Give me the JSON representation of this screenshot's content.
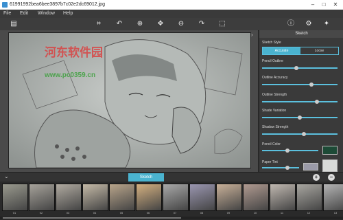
{
  "window": {
    "title": "61991992bea6bee3897b7c02e2dc69012.jpg",
    "minimize": "–",
    "maximize": "□",
    "close": "✕"
  },
  "menu": {
    "file": "File",
    "edit": "Edit",
    "window": "Window",
    "help": "Help"
  },
  "toolbar": {
    "icons": [
      "open-icon",
      "crop-icon",
      "undo-icon",
      "zoom-in-icon",
      "move-icon",
      "zoom-out-icon",
      "redo-icon",
      "fit-icon",
      "info-icon",
      "settings-icon",
      "effects-icon"
    ]
  },
  "watermark": {
    "text": "河东软件园",
    "url": "www.pc0359.cn"
  },
  "panel": {
    "header": "Sketch",
    "sketch_style_label": "Sketch Style",
    "style_options": [
      "Accurate",
      "Loose"
    ],
    "selected_style": "Accurate",
    "sliders": [
      {
        "label": "Pencil Outline",
        "value": 0.45
      },
      {
        "label": "Outline Accuracy",
        "value": 0.65
      },
      {
        "label": "Outline Strength",
        "value": 0.73
      },
      {
        "label": "Shade Variation",
        "value": 0.5
      },
      {
        "label": "Shadow Strength",
        "value": 0.55
      }
    ],
    "pencil_color_label": "Pencil Color",
    "pencil_color": "#1d4a36",
    "paper_tint_label": "Paper Tint",
    "paper_tint": "#9a9aa8"
  },
  "strip": {
    "tab_label": "Sketch",
    "add": "+",
    "remove": "−",
    "thumbnails": [
      "01",
      "02",
      "03",
      "04",
      "05",
      "06",
      "07",
      "08",
      "09",
      "10",
      "11",
      "12",
      "13"
    ]
  },
  "colors": {
    "accent": "#4ab3cf",
    "panel_bg": "#3a3a3a"
  }
}
